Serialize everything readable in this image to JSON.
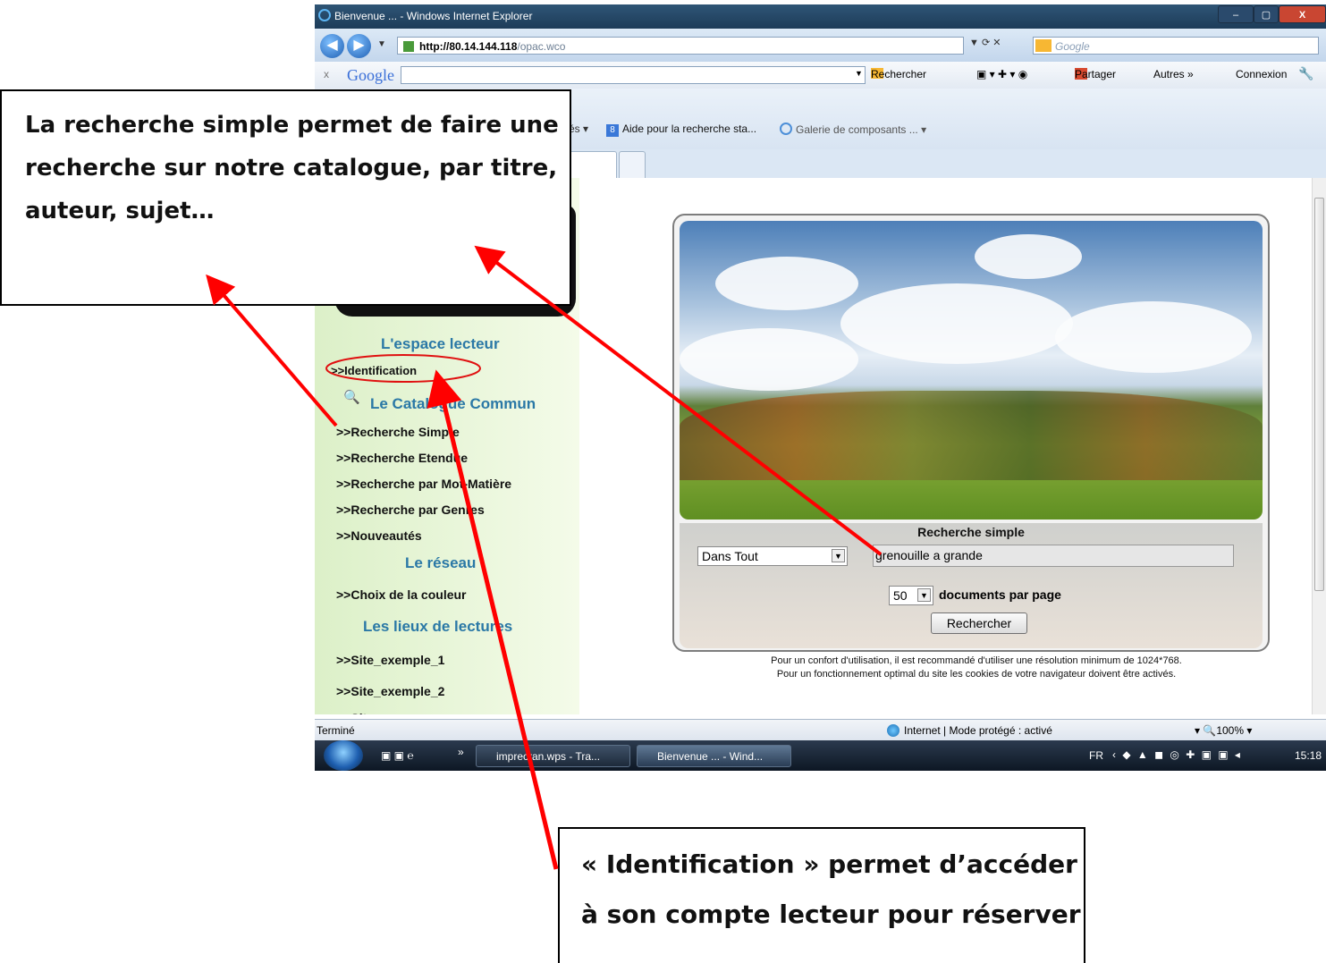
{
  "browser": {
    "window_title": "Bienvenue ... - Windows Internet Explorer",
    "url_host": "http://80.14.144.118",
    "url_path": "/opac.wco",
    "search_placeholder": "Google",
    "window_controls": [
      "–",
      "▢",
      "X"
    ]
  },
  "google_toolbar": {
    "close": "x",
    "logo": "Google",
    "search_label": "Rechercher",
    "share_label": "Partager",
    "more_label": "Autres »",
    "connect_label": "Connexion"
  },
  "favorites": {
    "item_0": "és",
    "item_1": "Aide pour la recherche sta...",
    "item_2": "Galerie de composants ..."
  },
  "sidebar": {
    "section_reader": "L'espace lecteur",
    "link_identification": ">>Identification",
    "section_catalog": "Le Catalogue Commun",
    "catalog_links": [
      ">>Recherche Simple",
      ">>Recherche Etendue",
      ">>Recherche par Mot-Matière",
      ">>Recherche par Genres",
      ">>Nouveautés"
    ],
    "section_network": "Le réseau",
    "link_color": ">>Choix de la couleur",
    "section_places": "Les lieux de lectures",
    "place_links": [
      ">>Site_exemple_1",
      ">>Site_exemple_2"
    ]
  },
  "search": {
    "title": "Recherche simple",
    "field_selected": "Dans Tout",
    "query": "grenouille a grande",
    "per_page_value": "50",
    "per_page_label": "documents par page",
    "button": "Rechercher"
  },
  "notes": {
    "line1": "Pour un confort d'utilisation, il est recommandé d'utiliser une résolution minimum de 1024*768.",
    "line2": "Pour un fonctionnement optimal du site les cookies de votre navigateur doivent être activés."
  },
  "statusbar": {
    "left": "Terminé",
    "zone": "Internet | Mode protégé : activé",
    "zoom": "100%"
  },
  "taskbar": {
    "chevron": "»",
    "task1": "imprecran.wps - Tra...",
    "task2": "Bienvenue ... - Wind...",
    "lang": "FR",
    "clock": "15:18"
  },
  "annotations": {
    "callout1": "La recherche simple permet de faire une recherche sur notre catalogue, par titre, auteur, sujet…",
    "callout2": "« Identification » permet d’accéder à son compte lecteur pour réserver"
  },
  "colors": {
    "arrow": "#ff0000",
    "section_blue": "#2a78a6",
    "sidebar_green": "#dcf0c8"
  }
}
